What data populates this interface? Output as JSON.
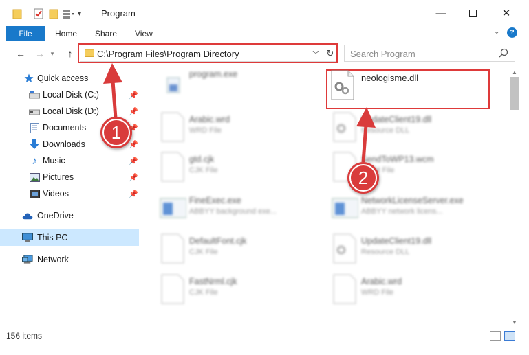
{
  "window": {
    "title": "Program",
    "minimize_icon": "minimize-icon",
    "maximize_icon": "maximize-icon",
    "close_icon": "close-icon"
  },
  "ribbon": {
    "tabs": [
      {
        "label": "File"
      },
      {
        "label": "Home"
      },
      {
        "label": "Share"
      },
      {
        "label": "View"
      }
    ],
    "file_tab_color": "#1979ca"
  },
  "navigation": {
    "address_path": "C:\\Program Files\\Program Directory",
    "search_placeholder": "Search Program"
  },
  "sidebar": {
    "items": [
      {
        "label": "Quick access",
        "icon": "star-icon"
      },
      {
        "label": "Local Disk (C:)",
        "icon": "drive-icon",
        "pinned": true
      },
      {
        "label": "Local Disk (D:)",
        "icon": "drive-icon",
        "pinned": true
      },
      {
        "label": "Documents",
        "icon": "documents-icon",
        "pinned": true
      },
      {
        "label": "Downloads",
        "icon": "download-icon",
        "pinned": true
      },
      {
        "label": "Music",
        "icon": "music-icon",
        "pinned": true
      },
      {
        "label": "Pictures",
        "icon": "pictures-icon",
        "pinned": true
      },
      {
        "label": "Videos",
        "icon": "videos-icon",
        "pinned": true
      },
      {
        "label": "OneDrive",
        "icon": "cloud-icon"
      },
      {
        "label": "This PC",
        "icon": "computer-icon",
        "selected": true
      },
      {
        "label": "Network",
        "icon": "network-icon"
      }
    ]
  },
  "files": [
    {
      "name": "program.exe",
      "type": "",
      "icon": "program-icon"
    },
    {
      "name": "neologisme.dll",
      "type": "",
      "icon": "dll-gear-icon"
    },
    {
      "name": "Arabic.wrd",
      "type": "WRD File",
      "icon": "file-icon"
    },
    {
      "name": "UpdateClient19.dll",
      "type": "Resource DLL",
      "icon": "dll-gear-icon"
    },
    {
      "name": "gtd.cjk",
      "type": "CJK File",
      "icon": "file-icon"
    },
    {
      "name": "SendToWP13.wcm",
      "type": "WCM File",
      "icon": "file-icon"
    },
    {
      "name": "FineExec.exe",
      "type": "ABBYY background exe...",
      "icon": "app-window-icon"
    },
    {
      "name": "NetworkLicenseServer.exe",
      "type": "ABBYY network licens...",
      "icon": "app-window-icon"
    },
    {
      "name": "DefaultFont.cjk",
      "type": "CJK File",
      "icon": "file-icon"
    },
    {
      "name": "UpdateClient19.dll",
      "type": "Resource DLL",
      "icon": "dll-gear-icon"
    },
    {
      "name": "FastNrml.cjk",
      "type": "CJK File",
      "icon": "file-icon"
    },
    {
      "name": "Arabic.wrd",
      "type": "WRD File",
      "icon": "file-icon"
    }
  ],
  "status": {
    "item_count": "156 items"
  },
  "annotations": {
    "callout_1": "1",
    "callout_2": "2",
    "highlight_color": "#de3a3a"
  }
}
